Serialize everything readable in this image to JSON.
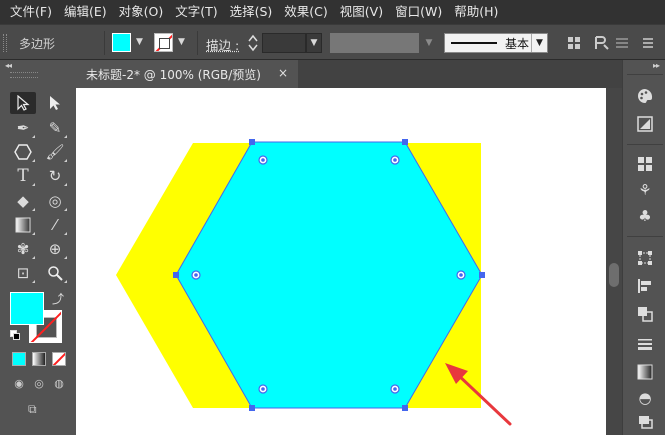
{
  "menu": {
    "items": [
      "文件(F)",
      "编辑(E)",
      "对象(O)",
      "文字(T)",
      "选择(S)",
      "效果(C)",
      "视图(V)",
      "窗口(W)",
      "帮助(H)"
    ]
  },
  "control_bar": {
    "selection_label": "多边形",
    "fill_color": "#00ffff",
    "stroke_color": "none",
    "stroke_label": "描边 :",
    "stroke_weight": "",
    "brush_label": "基本"
  },
  "tools": {
    "items": [
      "selection-tool",
      "direct-selection-tool",
      "pen-tool",
      "curvature-tool",
      "polygon-tool",
      "paintbrush-tool",
      "type-tool",
      "rotate-tool",
      "eraser-tool",
      "lasso-tool",
      "gradient-tool",
      "eyedropper-tool",
      "symbol-sprayer-tool",
      "shape-builder-tool",
      "artboard-tool",
      "zoom-tool"
    ]
  },
  "document": {
    "tab_title": "未标题-2* @ 100% (RGB/预览)",
    "close_glyph": "×"
  },
  "artwork": {
    "yellow_shape_color": "#ffff00",
    "hexagon_fill": "#00ffff",
    "hexagon_stroke": "#4466ee",
    "arrow_color": "#e8383d"
  },
  "right_panels": {
    "items": [
      "color-guide-icon",
      "appearance-icon",
      "swatches-icon",
      "brushes-icon",
      "symbols-icon",
      "transform-icon",
      "align-icon",
      "pathfinder-icon",
      "stroke-icon",
      "gradient-icon",
      "transparency-icon",
      "layers-icon"
    ]
  }
}
